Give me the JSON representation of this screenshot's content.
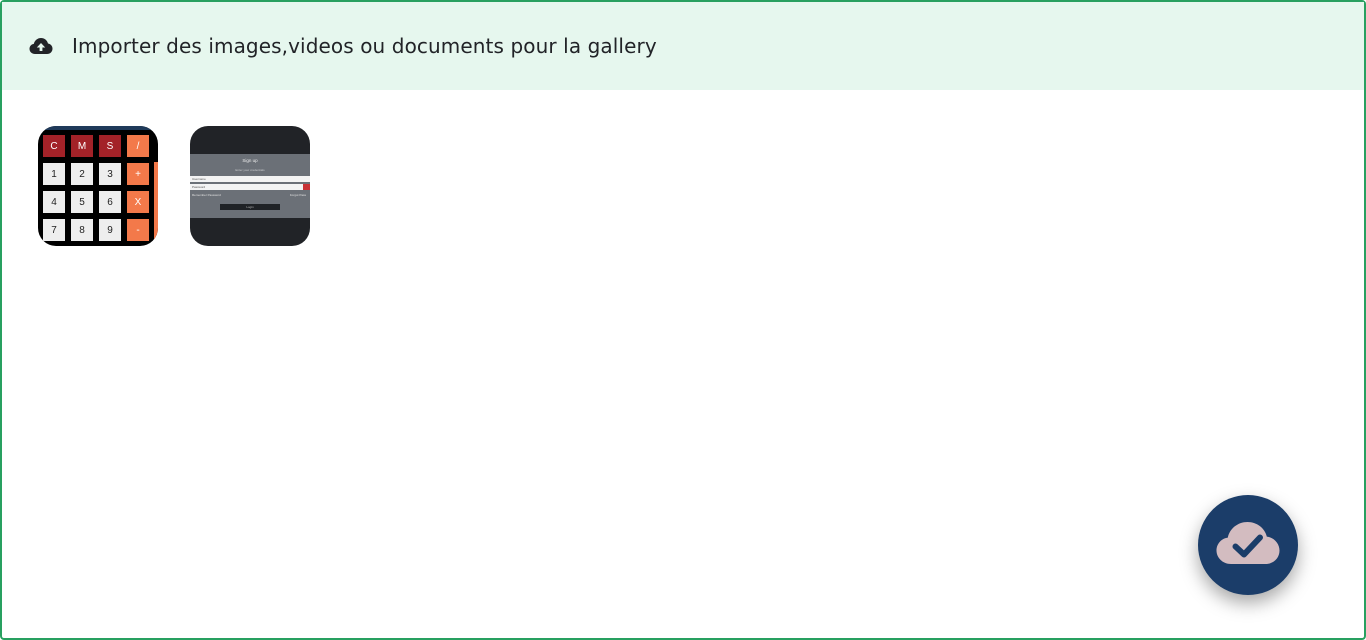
{
  "header": {
    "icon": "cloud-upload-icon",
    "title": "Importer des images,videos ou documents pour la gallery"
  },
  "gallery": {
    "items": [
      {
        "name": "calculator-screenshot",
        "keys": [
          "C",
          "M",
          "S",
          "/",
          "1",
          "2",
          "3",
          "+",
          "4",
          "5",
          "6",
          "X",
          "7",
          "8",
          "9",
          "-"
        ]
      },
      {
        "name": "login-form-screenshot",
        "heading": "Sign up",
        "subheading": "Enter your credentials",
        "field1": "Username",
        "field2": "Password",
        "remember": "Remember Password",
        "forgot": "Forgot Pass",
        "button": "Login"
      }
    ]
  },
  "fab": {
    "icon": "cloud-check-icon",
    "colors": {
      "background": "#1b3d69",
      "cloud": "#d3bcc0",
      "check": "#1b3d69"
    }
  },
  "colors": {
    "header_background": "#e6f7ee",
    "border": "#28a060"
  }
}
